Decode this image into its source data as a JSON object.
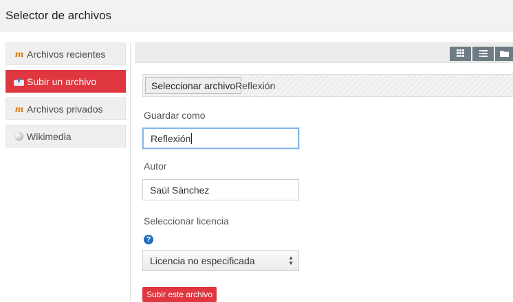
{
  "header": {
    "title": "Selector de archivos"
  },
  "sidebar": {
    "items": [
      {
        "label": "Archivos recientes",
        "icon": "moodle-icon",
        "active": false
      },
      {
        "label": "Subir un archivo",
        "icon": "upload-icon",
        "active": true
      },
      {
        "label": "Archivos privados",
        "icon": "moodle-icon",
        "active": false
      },
      {
        "label": "Wikimedia",
        "icon": "wikimedia-icon",
        "active": false
      }
    ]
  },
  "toolbar": {
    "views": [
      {
        "name": "icons-view",
        "icon": "grid-icon"
      },
      {
        "name": "list-view",
        "icon": "list-icon"
      },
      {
        "name": "tree-view",
        "icon": "folder-icon"
      }
    ]
  },
  "upload": {
    "choose_button": "Seleccionar archivo",
    "chosen_file": "Reflexión",
    "save_as_label": "Guardar como",
    "save_as_value": "Reflexión",
    "author_label": "Autor",
    "author_value": "Saúl Sánchez",
    "license_label": "Seleccionar licencia",
    "license_value": "Licencia no especificada",
    "submit_button": "Subir este archivo"
  },
  "colors": {
    "accent": "#e0363f",
    "toolbar_button": "#6f7c84",
    "help": "#1f6fbd"
  }
}
